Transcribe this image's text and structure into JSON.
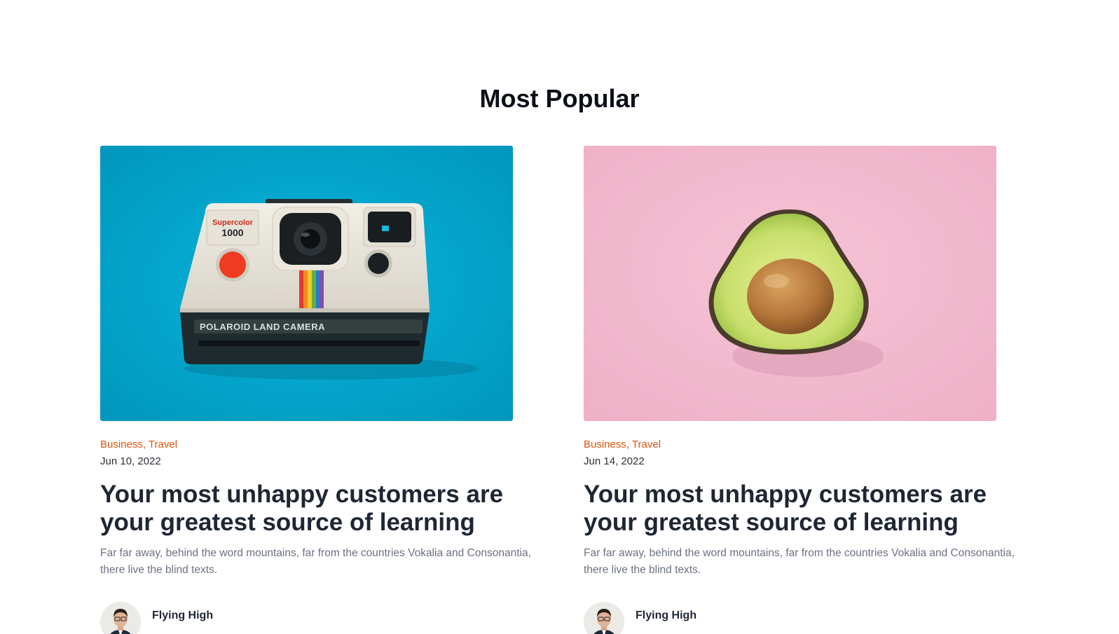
{
  "section": {
    "title": "Most Popular"
  },
  "posts": [
    {
      "image_icon": "polaroid-camera-photo",
      "image_text": {
        "brand": "Supercolor",
        "model": "1000",
        "camera_label": "POLAROID LAND CAMERA"
      },
      "categories": "Business, Travel",
      "date": "Jun 10, 2022",
      "title": "Your most unhappy customers are your greatest source of learning",
      "excerpt": "Far far away, behind the word mountains, far from the countries Vokalia and Consonantia, there live the blind texts.",
      "author": "Flying High"
    },
    {
      "image_icon": "avocado-half-photo",
      "categories": "Business, Travel",
      "date": "Jun 14, 2022",
      "title": "Your most unhappy customers are your greatest source of learning",
      "excerpt": "Far far away, behind the word mountains, far from the countries Vokalia and Consonantia, there live the blind texts.",
      "author": "Flying High"
    }
  ],
  "colors": {
    "category": "#e0530b",
    "camera_bg": "#04a8cf",
    "avocado_bg": "#f3bcd0"
  }
}
